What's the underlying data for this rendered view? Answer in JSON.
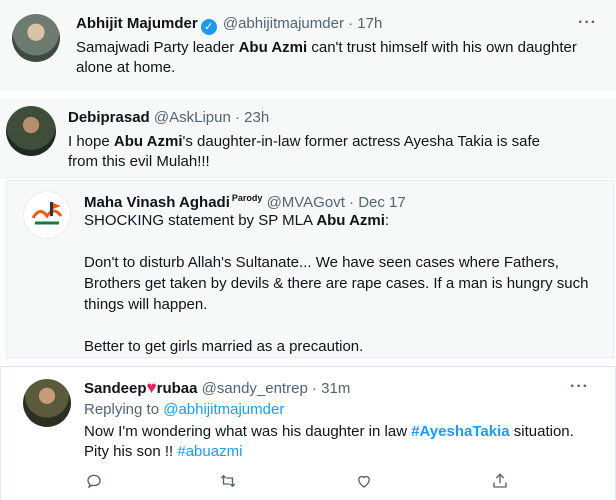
{
  "tweets": [
    {
      "name": "Abhijit Majumder",
      "handle": "@abhijitmajumder",
      "time": "17h",
      "text_lines": [
        [
          "Samajwadi Party leader ",
          "Abu Azmi",
          " can't trust himself with his own daughter"
        ],
        [
          "alone at home."
        ]
      ]
    },
    {
      "name": "Debiprasad",
      "handle": "@AskLipun",
      "time": "23h",
      "text_lines": [
        [
          "I hope ",
          "Abu Azmi",
          "'s daughter-in-law former actress Ayesha Takia is safe"
        ],
        [
          "from this evil Mulah!!!"
        ]
      ]
    },
    {
      "name": "Maha Vinash Aghadi",
      "parody_badge": "Parody",
      "handle": "@MVAGovt",
      "time": "Dec 17",
      "text_lines": [
        [
          "SHOCKING statement by SP MLA ",
          "Abu Azmi",
          ":"
        ],
        [
          ""
        ],
        [
          "Don't to disturb Allah's Sultanate... We have seen cases where Fathers,"
        ],
        [
          "Brothers get taken by devils & there are rape cases. If a man is hungry such"
        ],
        [
          "things will happen."
        ],
        [
          ""
        ],
        [
          "Better to get girls married as a precaution."
        ]
      ]
    },
    {
      "name_part1": "Sandeep",
      "name_part2": "rubaa",
      "heart": "♥",
      "handle": "@sandy_entrep",
      "time": "31m",
      "replying_label": "Replying to",
      "replying_to": "@abhijitmajumder",
      "line1_text": "Now I'm wondering what was his daughter in law ",
      "line1_hashtag": "#AyeshaTakia",
      "line1_end": " situation.",
      "line2_text": "Pity his son !! ",
      "line2_hashtag": "#abuazmi"
    }
  ],
  "separator": "·",
  "more_icon": "···",
  "verified_icon": "✓",
  "actions": [
    "reply-icon",
    "retweet-icon",
    "like-icon",
    "share-icon"
  ],
  "colors": {
    "accent": "#1d9bf0",
    "heart": "#e0245e",
    "muted": "#536471",
    "quoted_bg": "#f7f9f9"
  }
}
